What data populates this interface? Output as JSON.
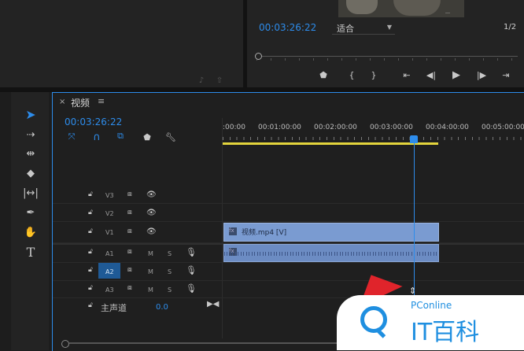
{
  "program_monitor": {
    "timecode": "00:03:26:22",
    "fit_label": "适合",
    "page_indicator": "1/2"
  },
  "timeline": {
    "tab_title": "视频",
    "timecode": "00:03:26:22",
    "ruler_labels": [
      ":00:00",
      "00:01:00:00",
      "00:02:00:00",
      "00:03:00:00",
      "00:04:00:00",
      "00:05:00:00"
    ],
    "tracks": {
      "v3": "V3",
      "v2": "V2",
      "v1": "V1",
      "a1": "A1",
      "a2": "A2",
      "a3": "A3",
      "m": "M",
      "s": "S"
    },
    "master_label": "主声道",
    "master_value": "0.0",
    "video_clip": "视频.mp4 [V]"
  },
  "watermark": {
    "brand": "PConline",
    "title": "IT百科"
  },
  "colors": {
    "accent": "#2d8ceb",
    "clip": "#7a9bd1",
    "work_area": "#e3d43d",
    "watermark_red": "#e0242b"
  }
}
